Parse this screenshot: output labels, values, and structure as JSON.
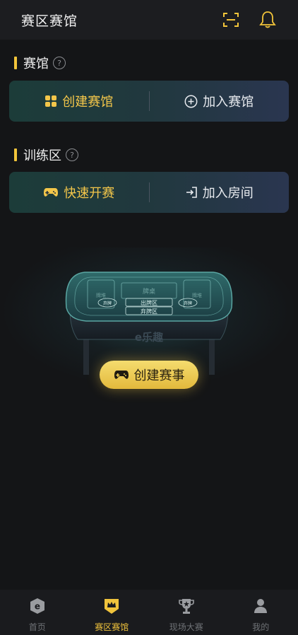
{
  "header": {
    "title": "赛区赛馆",
    "scan_icon": "scan-icon",
    "bell_icon": "bell-icon"
  },
  "venue_section": {
    "title": "赛馆",
    "help": "?",
    "create_label": "创建赛馆",
    "create_icon": "venue-grid-icon",
    "join_label": "加入赛馆",
    "join_icon": "plus-circle-icon"
  },
  "training_section": {
    "title": "训练区",
    "help": "?",
    "quick_label": "快速开赛",
    "quick_icon": "gamepad-icon",
    "join_room_label": "加入房间",
    "join_room_icon": "enter-icon"
  },
  "table": {
    "brand": "e乐趣",
    "zone_out": "出牌区",
    "zone_discard": "弃牌区",
    "zone_center": "牌桌",
    "zone_left": "牌堆",
    "zone_right": "牌堆",
    "circle_left": "弃牌",
    "circle_right": "弃牌"
  },
  "create_match": {
    "label": "创建赛事",
    "icon": "gamepad-icon"
  },
  "tabbar": {
    "items": [
      {
        "label": "首页",
        "icon": "home-e-icon",
        "active": false
      },
      {
        "label": "赛区赛馆",
        "icon": "crown-badge-icon",
        "active": true
      },
      {
        "label": "现场大赛",
        "icon": "trophy-icon",
        "active": false
      },
      {
        "label": "我的",
        "icon": "person-icon",
        "active": false
      }
    ]
  },
  "colors": {
    "accent": "#f3c53a",
    "background": "#141517",
    "card_start": "#1c3c39",
    "card_end": "#2a3650"
  }
}
